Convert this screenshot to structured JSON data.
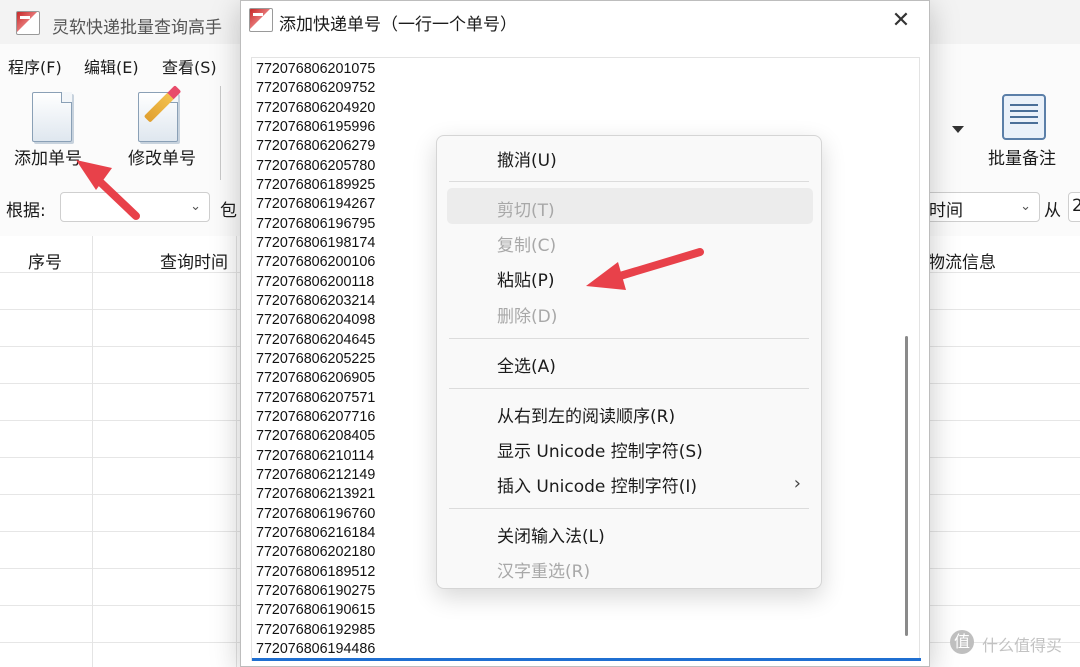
{
  "main_window": {
    "title": "灵软快递批量查询高手",
    "menu": [
      "程序(F)",
      "编辑(E)",
      "查看(S)"
    ],
    "toolbar": {
      "add_label": "添加单号",
      "edit_label": "修改单号",
      "batch_note_label": "批量备注"
    },
    "filter": {
      "by_label": "根据:",
      "bao_partial": "包",
      "time_combo": "时间",
      "from_label": "从",
      "from_partial": "2"
    },
    "table_headers": [
      "序号",
      "查询时间",
      "物流信息"
    ]
  },
  "dialog": {
    "title": "添加快递单号（一行一个单号）",
    "close_icon": "close-icon",
    "tracking_numbers": [
      "772076806201075",
      "772076806209752",
      "772076806204920",
      "772076806195996",
      "772076806206279",
      "772076806205780",
      "772076806189925",
      "772076806194267",
      "772076806196795",
      "772076806198174",
      "772076806200106",
      "772076806200118",
      "772076806203214",
      "772076806204098",
      "772076806204645",
      "772076806205225",
      "772076806206905",
      "772076806207571",
      "772076806207716",
      "772076806208405",
      "772076806210114",
      "772076806212149",
      "772076806213921",
      "772076806196760",
      "772076806216184",
      "772076806202180",
      "772076806189512",
      "772076806190275",
      "772076806190615",
      "772076806192985",
      "772076806194486"
    ]
  },
  "context_menu": {
    "items": [
      {
        "label": "撤消(U)",
        "enabled": true
      },
      {
        "label": "剪切(T)",
        "enabled": false
      },
      {
        "label": "复制(C)",
        "enabled": false
      },
      {
        "label": "粘贴(P)",
        "enabled": true
      },
      {
        "label": "删除(D)",
        "enabled": false
      },
      {
        "label": "全选(A)",
        "enabled": true
      },
      {
        "label": "从右到左的阅读顺序(R)",
        "enabled": true
      },
      {
        "label": "显示 Unicode 控制字符(S)",
        "enabled": true
      },
      {
        "label": "插入 Unicode 控制字符(I)",
        "enabled": true,
        "submenu": true
      },
      {
        "label": "关闭输入法(L)",
        "enabled": true
      },
      {
        "label": "汉字重选(R)",
        "enabled": false
      }
    ],
    "submenu_icon": "chevron-right-icon"
  },
  "annotation_color": "#e8414a",
  "watermark": {
    "logo_glyph": "值",
    "text": "什么值得买"
  }
}
